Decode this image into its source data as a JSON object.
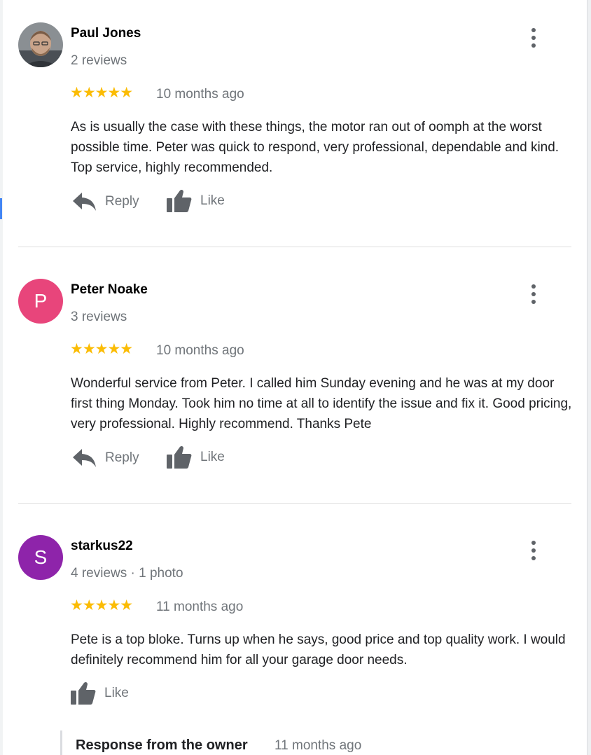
{
  "reviews": [
    {
      "name": "Paul Jones",
      "meta": "2 reviews",
      "stars": "★★★★★",
      "rating": 5,
      "date": "10 months ago",
      "text": "As is usually the case with these things, the motor ran out of oomph at the worst possible time. Peter was quick to respond, very professional, dependable and kind. Top service, highly recommended.",
      "reply_label": "Reply",
      "like_label": "Like"
    },
    {
      "name": "Peter Noake",
      "avatar_letter": "P",
      "avatar_color": "#e8457b",
      "meta": "3 reviews",
      "stars": "★★★★★",
      "rating": 5,
      "date": "10 months ago",
      "text": "Wonderful service from Peter. I called him Sunday evening and he was at my door first thing Monday. Took him no time at all to identify the issue and fix it. Good pricing, very professional. Highly recommend. Thanks Pete",
      "reply_label": "Reply",
      "like_label": "Like"
    },
    {
      "name": "starkus22",
      "avatar_letter": "S",
      "avatar_color": "#8e24aa",
      "meta": "4 reviews · 1 photo",
      "stars": "★★★★★",
      "rating": 5,
      "date": "11 months ago",
      "text": "Pete is a top bloke. Turns up when he says, good price and top quality work. I would definitely recommend him for all your garage door needs.",
      "like_label": "Like"
    }
  ],
  "owner_response": {
    "title": "Response from the owner",
    "date": "11 months ago"
  },
  "colors": {
    "star": "#fbbc04",
    "muted_text": "#70757a",
    "icon": "#5f6368"
  }
}
